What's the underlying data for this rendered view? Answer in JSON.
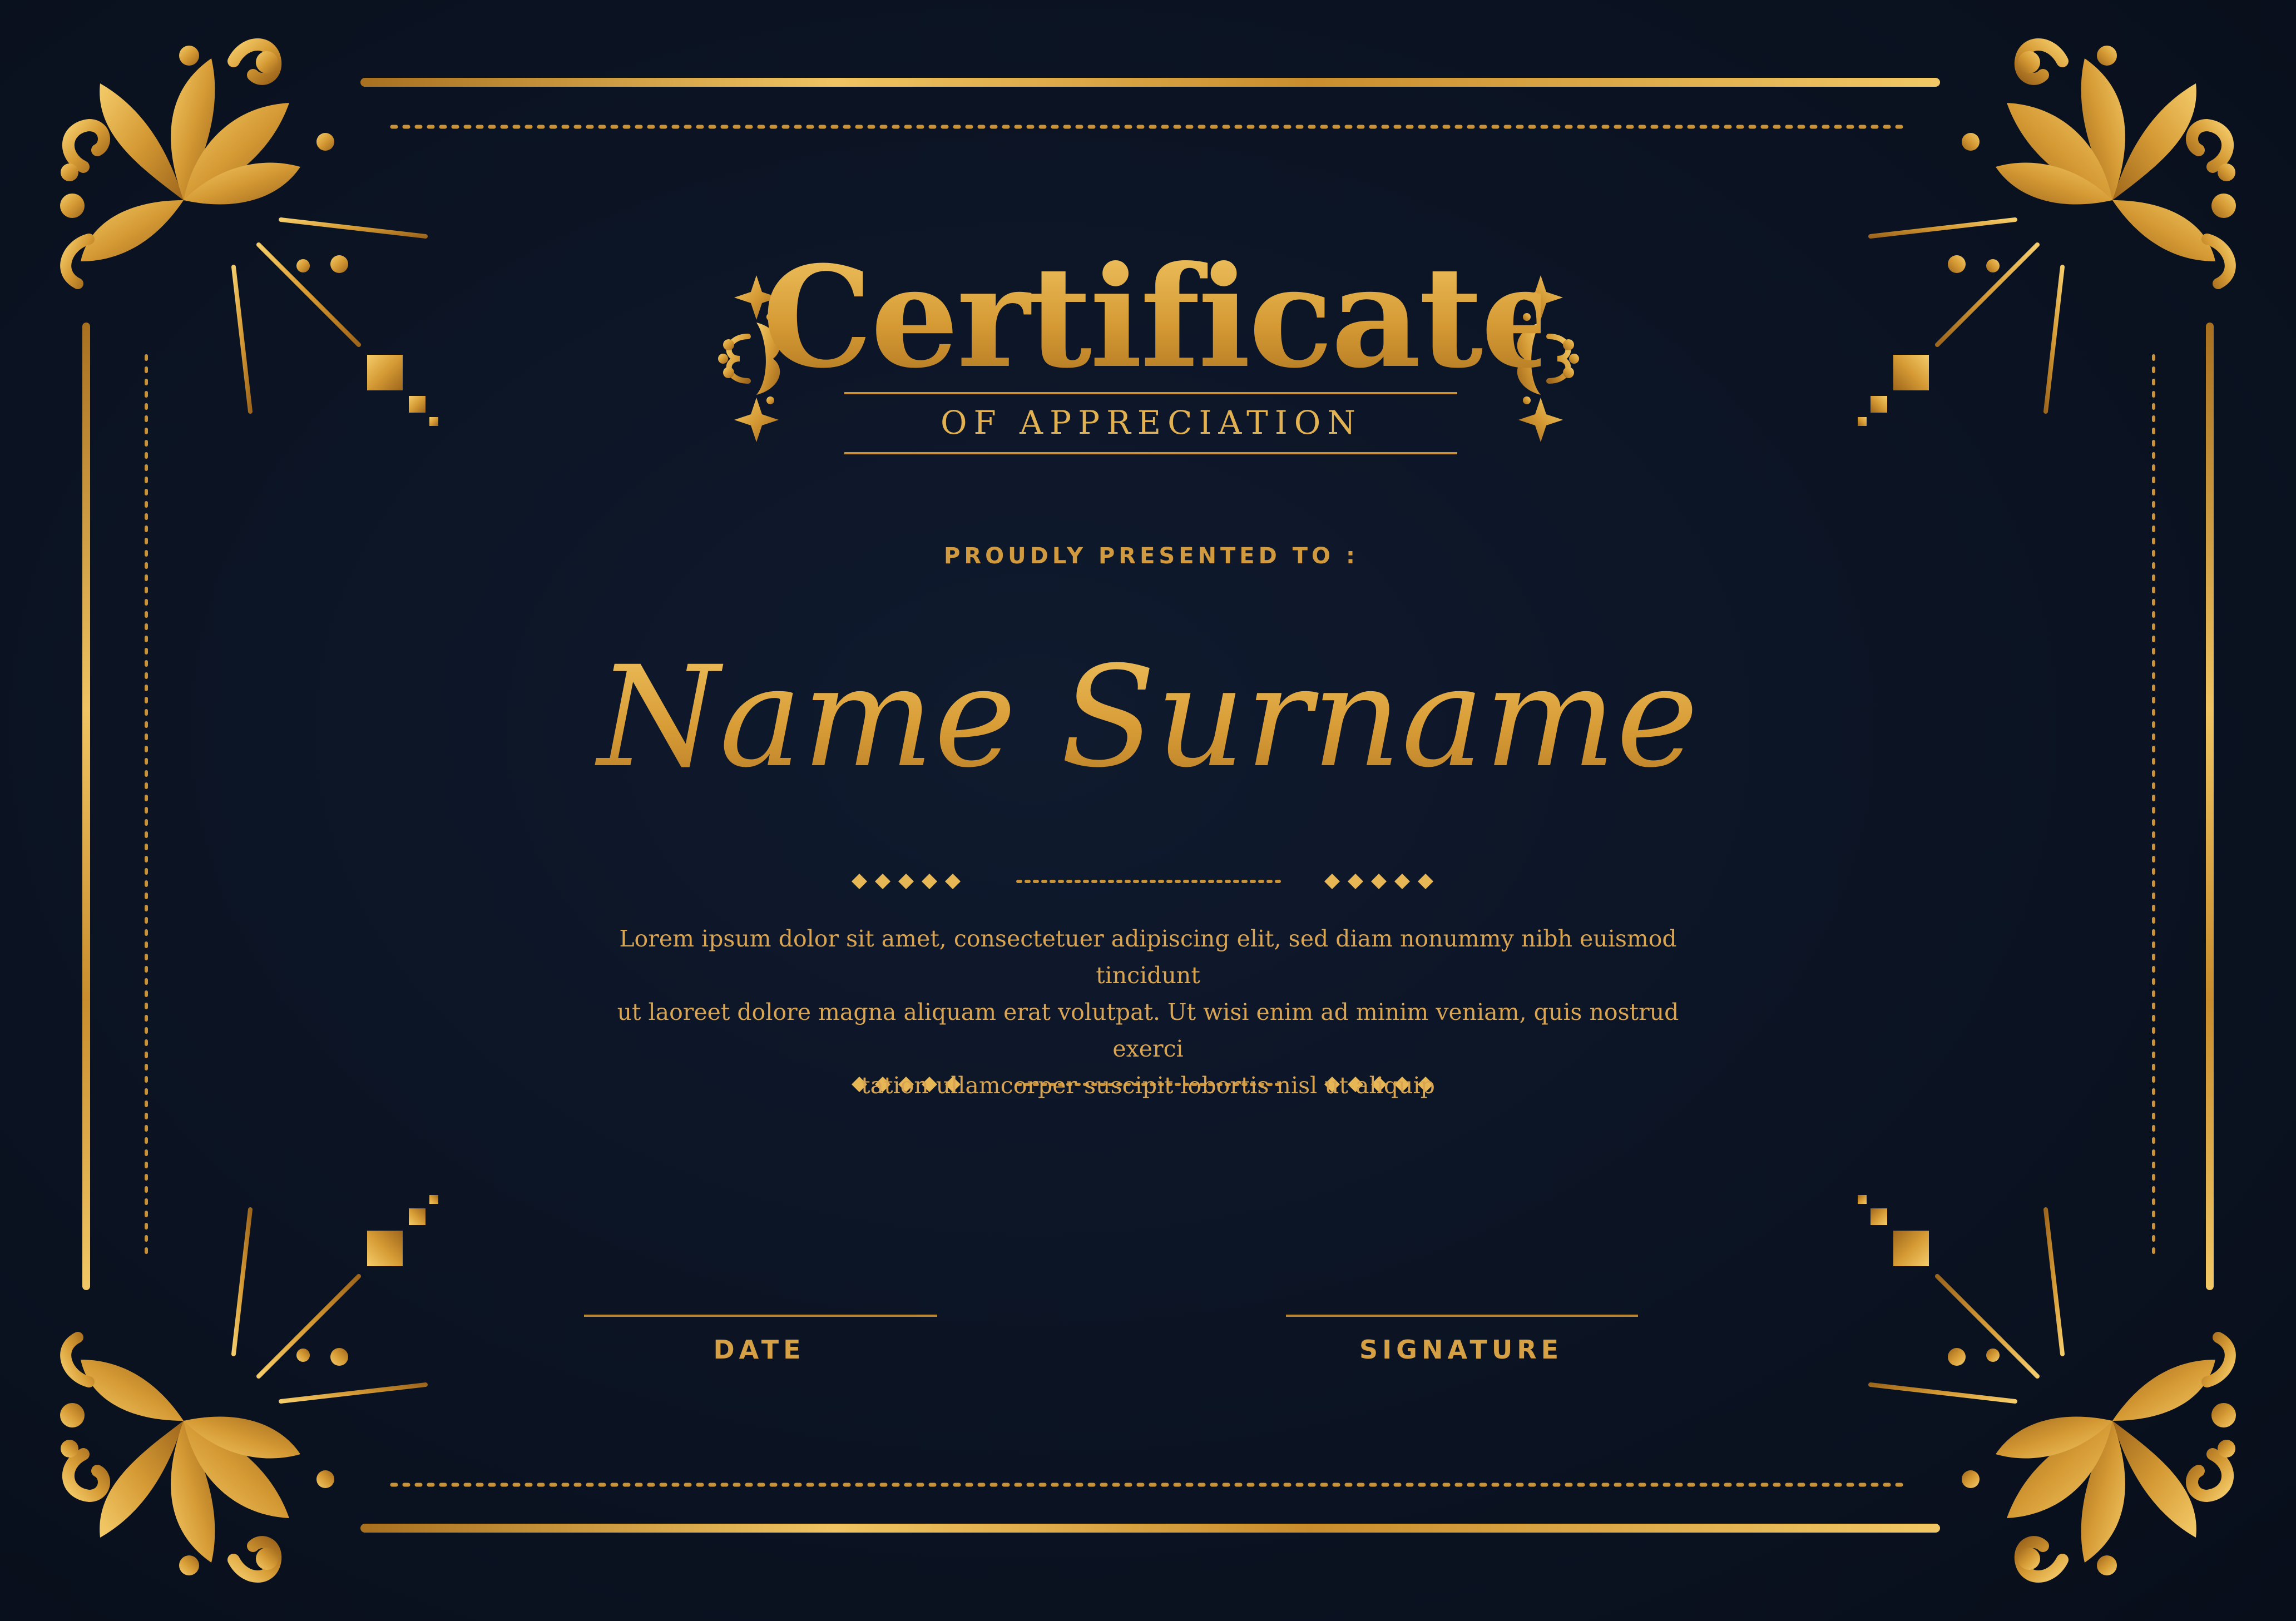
{
  "certificate": {
    "title": "Certificate",
    "subtitle": "OF APPRECIATION",
    "presented_to": "PROUDLY PRESENTED TO :",
    "recipient_name": "Name Surname",
    "body_lines": [
      "Lorem ipsum dolor sit amet, consectetuer adipiscing elit, sed diam nonummy nibh euismod tincidunt",
      "ut laoreet dolore magna aliquam erat volutpat. Ut wisi enim ad minim veniam, quis nostrud exerci",
      "tation ullamcorper suscipit lobortis nisl ut aliquip"
    ],
    "date_label": "DATE",
    "signature_label": "SIGNATURE"
  },
  "colors": {
    "background": "#0c1424",
    "gold_light": "#f4cc6a",
    "gold": "#d59a34",
    "gold_dark": "#a66d1f"
  },
  "decorations": {
    "corner_ornament": "flourish-icon",
    "title_side_ornament": "filigree-icon",
    "separator_ornament": "diamond-row-icon"
  }
}
